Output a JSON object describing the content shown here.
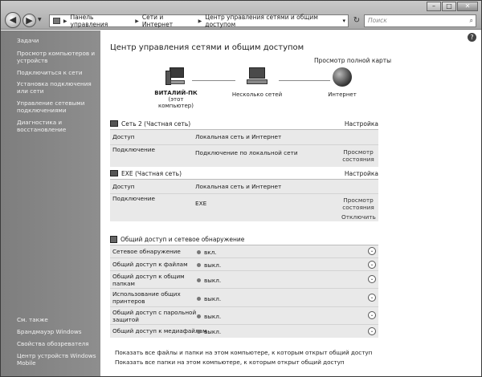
{
  "window": {
    "min": "–",
    "max": "□",
    "close": "✕"
  },
  "nav": {
    "back": "◀",
    "forward": "▶"
  },
  "address": {
    "crumbs": [
      "Панель управления",
      "Сети и Интернет",
      "Центр управления сетями и общим доступом"
    ]
  },
  "search": {
    "placeholder": "Поиск",
    "icon": "search-icon"
  },
  "sidebar": {
    "tasks_title": "Задачи",
    "items": [
      "Просмотр компьютеров и устройств",
      "Подключиться к сети",
      "Установка подключения или сети",
      "Управление сетевыми подключениями",
      "Диагностика и восстановление"
    ],
    "see_also_title": "См. также",
    "see_also": [
      "Брандмауэр Windows",
      "Свойства обозревателя",
      "Центр устройств Windows Mobile"
    ]
  },
  "main": {
    "title": "Центр управления сетями и общим доступом",
    "view_full_map": "Просмотр полной карты",
    "map": {
      "computer": "ВИТАЛИЙ-ПК",
      "computer_sub": "(этот компьютер)",
      "networks": "Несколько сетей",
      "internet": "Интернет"
    },
    "networks": [
      {
        "name": "Сеть  2 (Частная сеть)",
        "configure": "Настройка",
        "access_label": "Доступ",
        "access_value": "Локальная сеть и Интернет",
        "connection_label": "Подключение",
        "connection_value": "Подключение по локальной сети",
        "view_status": "Просмотр состояния",
        "disconnect": ""
      },
      {
        "name": "EXE (Частная сеть)",
        "configure": "Настройка",
        "access_label": "Доступ",
        "access_value": "Локальная сеть и Интернет",
        "connection_label": "Подключение",
        "connection_value": "EXE",
        "view_status": "Просмотр состояния",
        "disconnect": "Отключить"
      }
    ],
    "sharing": {
      "title": "Общий доступ и сетевое обнаружение",
      "rows": [
        {
          "label": "Сетевое обнаружение",
          "value": "вкл."
        },
        {
          "label": "Общий доступ к файлам",
          "value": "выкл."
        },
        {
          "label": "Общий доступ к общим папкам",
          "value": "выкл."
        },
        {
          "label": "Использование общих принтеров",
          "value": "выкл."
        },
        {
          "label": "Общий доступ с парольной защитой",
          "value": "выкл."
        },
        {
          "label": "Общий доступ к медиафайлам",
          "value": "выкл."
        }
      ]
    },
    "links": [
      "Показать все файлы и папки на этом компьютере, к которым открыт общий доступ",
      "Показать все папки на этом компьютере, к которым открыт общий доступ"
    ]
  }
}
